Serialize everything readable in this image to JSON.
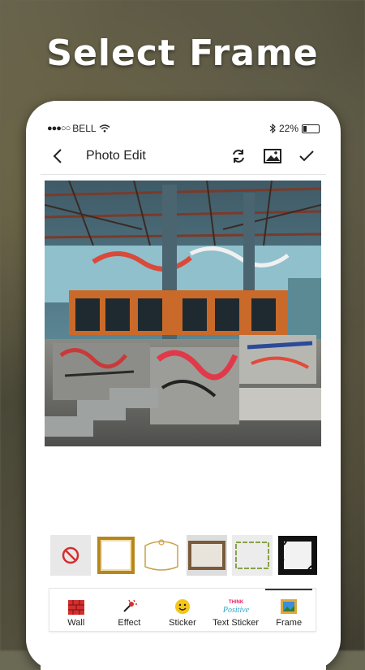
{
  "headline": "Select Frame",
  "status_bar": {
    "carrier": "BELL",
    "battery_percent": "22%",
    "battery_level": 0.22
  },
  "app_bar": {
    "title": "Photo Edit",
    "back_icon": "back-arrow-icon",
    "actions": [
      "refresh-icon",
      "image-icon",
      "check-icon"
    ]
  },
  "frames": [
    {
      "id": "none",
      "icon": "no-frame-icon"
    },
    {
      "id": "gold"
    },
    {
      "id": "ornate"
    },
    {
      "id": "wood"
    },
    {
      "id": "bamboo"
    },
    {
      "id": "grunge"
    }
  ],
  "tools": [
    {
      "label": "Wall",
      "icon": "wall-icon"
    },
    {
      "label": "Effect",
      "icon": "effect-icon"
    },
    {
      "label": "Sticker",
      "icon": "sticker-icon"
    },
    {
      "label": "Text Sticker",
      "icon": "text-sticker-icon",
      "sticker_text": [
        "THINK",
        "Positive"
      ]
    },
    {
      "label": "Frame",
      "icon": "frame-icon",
      "active": true
    }
  ],
  "colors": {
    "accent": "#d32f2f",
    "sticker": "#f5c518"
  }
}
